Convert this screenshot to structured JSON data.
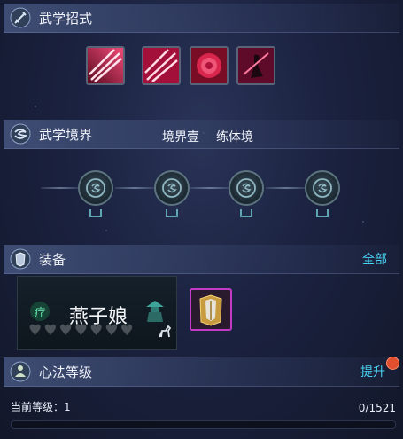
{
  "martial_skills": {
    "title": "武学招式",
    "icon": "sword-icon",
    "skills": [
      {
        "icon": "crimson-slash-icon"
      },
      {
        "icon": "crimson-slash-icon"
      },
      {
        "icon": "rose-blossom-icon"
      },
      {
        "icon": "swordsman-silhouette-icon"
      }
    ]
  },
  "realm": {
    "title": "武学境界",
    "icon": "swirl-icon",
    "stage": "境界壹",
    "stage_name": "练体境",
    "nodes": [
      {
        "icon": "locked-spiral-icon"
      },
      {
        "icon": "locked-spiral-icon"
      },
      {
        "icon": "locked-spiral-icon"
      },
      {
        "icon": "locked-spiral-icon"
      }
    ]
  },
  "equipment": {
    "title": "装备",
    "icon": "armor-icon",
    "all_link": "全部",
    "card": {
      "badge": "疗",
      "name": "燕子娘",
      "hearts_total": 7,
      "hearts_filled": 0
    },
    "item_icon": "golden-armor-icon"
  },
  "mind_method": {
    "title": "心法等级",
    "icon": "meditation-icon",
    "upgrade_label": "提升",
    "level_label": "当前等级：1",
    "progress_text": "0/1521",
    "progress_fraction": 0
  },
  "colors": {
    "accent": "#49d2f3",
    "notification": "#e0502e",
    "item_border": "#c23bc6"
  }
}
